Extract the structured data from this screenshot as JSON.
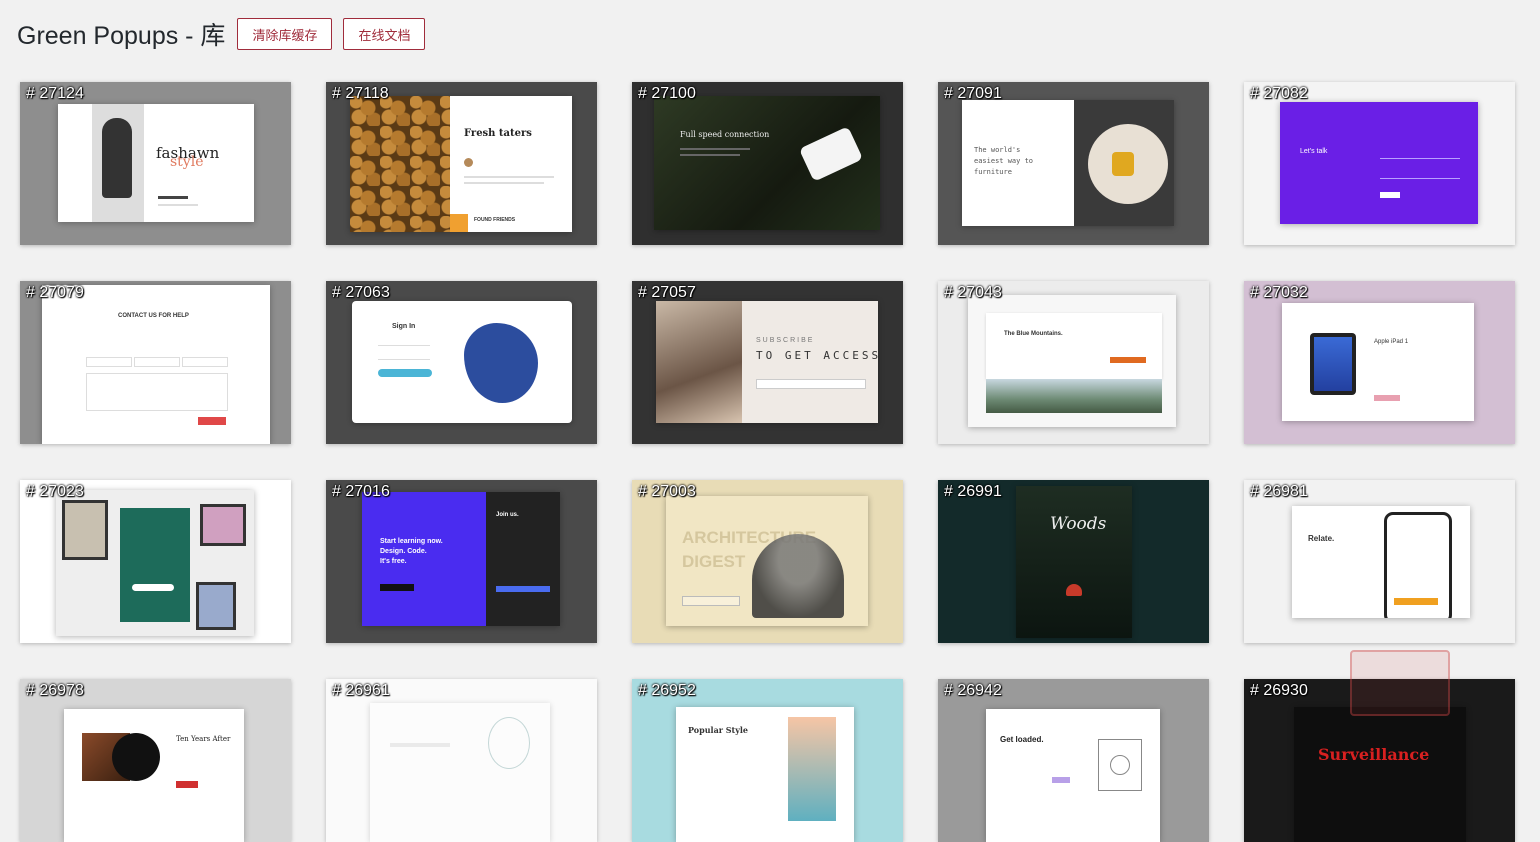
{
  "header": {
    "title": "Green Popups - 库",
    "clear_cache_label": "清除库缓存",
    "online_docs_label": "在线文档"
  },
  "cards": [
    {
      "id": "# 27124"
    },
    {
      "id": "# 27118"
    },
    {
      "id": "# 27100"
    },
    {
      "id": "# 27091"
    },
    {
      "id": "# 27082"
    },
    {
      "id": "# 27079"
    },
    {
      "id": "# 27063"
    },
    {
      "id": "# 27057"
    },
    {
      "id": "# 27043"
    },
    {
      "id": "# 27032"
    },
    {
      "id": "# 27023"
    },
    {
      "id": "# 27016"
    },
    {
      "id": "# 27003"
    },
    {
      "id": "# 26991"
    },
    {
      "id": "# 26981"
    },
    {
      "id": "# 26978"
    },
    {
      "id": "# 26961"
    },
    {
      "id": "# 26952"
    },
    {
      "id": "# 26942"
    },
    {
      "id": "# 26930"
    }
  ],
  "thumbs": {
    "t27124": {
      "brand": "fashawn",
      "brand2": "style"
    },
    "t27118": {
      "title": "Fresh taters",
      "footer": "FOUND FRIENDS"
    },
    "t27100": {
      "title": "Full speed connection"
    },
    "t27091": {
      "line1": "The world's",
      "line2": "easiest way to",
      "line3": "furniture"
    },
    "t27082": {
      "title": "Let's talk"
    },
    "t27079": {
      "title": "CONTACT US FOR HELP"
    },
    "t27063": {
      "title": "Sign In"
    },
    "t27057": {
      "line1": "SUBSCRIBE",
      "line2": "TO GET ACCESS"
    },
    "t27043": {
      "title": "The Blue Mountains."
    },
    "t27032": {
      "title": "Apple iPad 1"
    },
    "t27016": {
      "line1": "Start learning now.",
      "line2": "Design. Code.",
      "line3": "It's free.",
      "side": "Join us."
    },
    "t27003": {
      "line1": "ARCHITECTURE",
      "line2": "DIGEST"
    },
    "t26991": {
      "title": "Woods"
    },
    "t26981": {
      "title": "Relate."
    },
    "t26978": {
      "title": "Ten Years After"
    },
    "t26952": {
      "title": "Popular Style"
    },
    "t26942": {
      "title": "Get loaded."
    },
    "t26930": {
      "title": "Surveillance"
    }
  },
  "colors": {
    "accent": "#a02c3b",
    "background": "#f1f1f1",
    "purple": "#6a1fe6",
    "indigo": "#4a2cf0",
    "dark": "#2b2b2b",
    "teal": "#1d6b5a",
    "beige": "#e8dcb6",
    "mauve": "#d3bfd3"
  }
}
